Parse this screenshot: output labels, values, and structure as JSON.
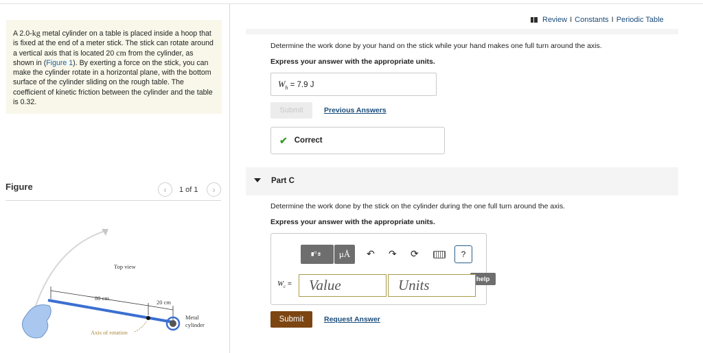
{
  "problem": {
    "part1": "A 2.0-",
    "kg": "kg",
    "part2": " metal cylinder on a table is placed inside a hoop that is fixed at the end of a meter stick. The stick can rotate around a vertical axis that is located 20 ",
    "cm": "cm",
    "part3": " from the cylinder, as shown in (",
    "figure_link": "Figure 1",
    "part4": "). By exerting a force on the stick, you can make the cylinder rotate in a horizontal plane, with the bottom surface of the cylinder sliding on the rough table. The coefficient of kinetic friction between the cylinder and the table is 0.32."
  },
  "figure": {
    "label": "Figure",
    "page": "1 of 1",
    "prev_icon": "chevron-left-icon",
    "next_icon": "chevron-right-icon",
    "top_view": "Top view",
    "dim_80": "80 cm",
    "dim_20": "20 cm",
    "metal": "Metal",
    "cylinder": "cylinder",
    "axis": "Axis of rotation"
  },
  "header_links": {
    "review": "Review",
    "constants": "Constants",
    "periodic_table": "Periodic Table",
    "sep": "I"
  },
  "part_b": {
    "question": "Determine the work done by your hand on the stick while your hand makes one full turn around the axis.",
    "instruction": "Express your answer with the appropriate units.",
    "answer_var": "W",
    "answer_sub": "h",
    "answer_value": " = 7.9 J",
    "submit": "Submit",
    "previous_answers": "Previous Answers",
    "status": "Correct"
  },
  "part_c": {
    "title": "Part C",
    "question": "Determine the work done by the stick on the cylinder during the one full turn around the axis.",
    "instruction": "Express your answer with the appropriate units.",
    "var": "W",
    "sub": "c",
    "eq": " =",
    "value_placeholder": "Value",
    "units_placeholder": "Units",
    "mu_label": "μÅ",
    "help_q": "?",
    "help_tab": "help",
    "submit": "Submit",
    "request_answer": "Request Answer"
  },
  "colors": {
    "accent_brown": "#7c4512",
    "link_blue": "#1a4c7a",
    "stick_blue": "#3b6fd1",
    "correct_green": "#3b9a2c"
  }
}
